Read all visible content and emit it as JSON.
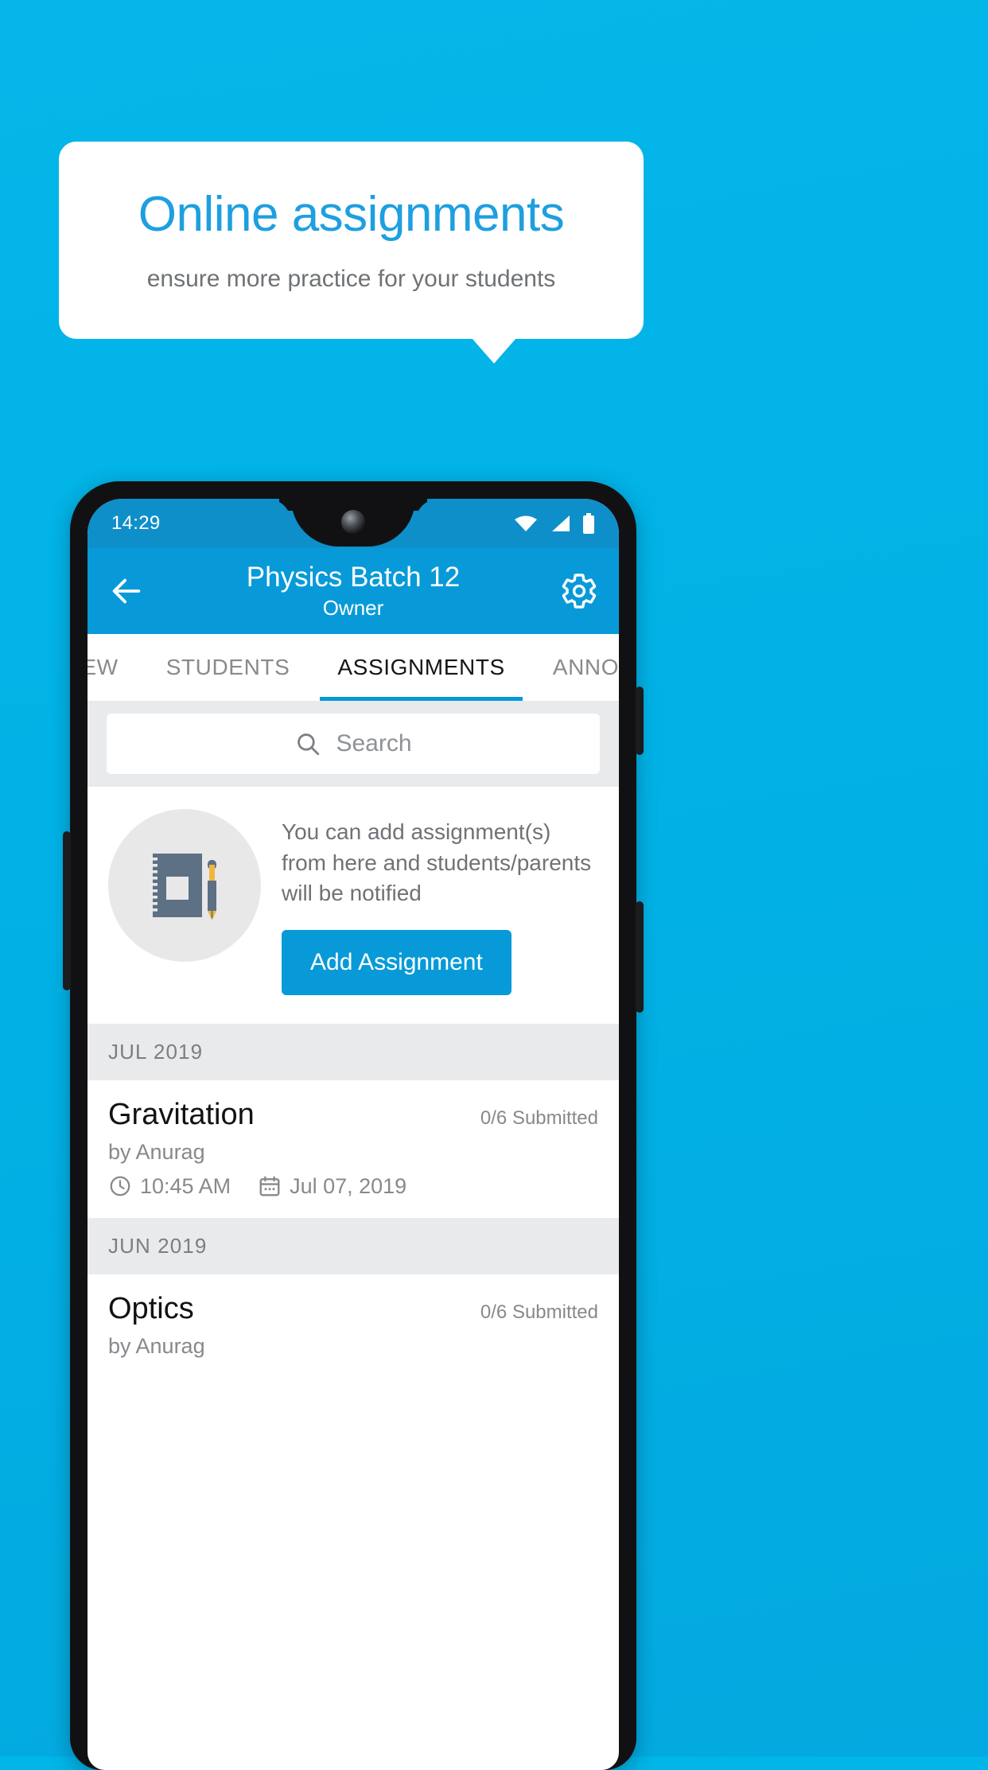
{
  "promo": {
    "title": "Online assignments",
    "subtitle": "ensure more practice for your students",
    "title_color": "#1e9fe0",
    "background_color": "#00b5e8"
  },
  "phone": {
    "status_bar": {
      "time": "14:29",
      "icons": [
        "wifi-icon",
        "signal-icon",
        "battery-icon"
      ],
      "background_color": "#0f8fc9"
    },
    "app_bar": {
      "back_icon": "back-arrow-icon",
      "title": "Physics Batch 12",
      "subtitle": "Owner",
      "settings_icon": "gear-icon",
      "background_color": "#089ad8"
    },
    "tabs": [
      {
        "label": "IEW",
        "active": false
      },
      {
        "label": "STUDENTS",
        "active": false
      },
      {
        "label": "ASSIGNMENTS",
        "active": true
      },
      {
        "label": "ANNOUNCEMENTS",
        "active": false
      }
    ],
    "search": {
      "icon": "search-icon",
      "placeholder": "Search",
      "value": ""
    },
    "empty_state": {
      "illustration": "notebook-and-pen-icon",
      "message": "You can add assignment(s) from here and students/parents will be notified",
      "button_label": "Add Assignment",
      "button_color": "#089ad8"
    },
    "sections": [
      {
        "month": "JUL 2019",
        "items": [
          {
            "title": "Gravitation",
            "submitted": "0/6 Submitted",
            "author": "by Anurag",
            "time_icon": "clock-icon",
            "time": "10:45 AM",
            "date_icon": "calendar-icon",
            "date": "Jul 07, 2019"
          }
        ]
      },
      {
        "month": "JUN 2019",
        "items": [
          {
            "title": "Optics",
            "submitted": "0/6 Submitted",
            "author": "by Anurag",
            "time_icon": "clock-icon",
            "time": "",
            "date_icon": "calendar-icon",
            "date": ""
          }
        ]
      }
    ]
  }
}
